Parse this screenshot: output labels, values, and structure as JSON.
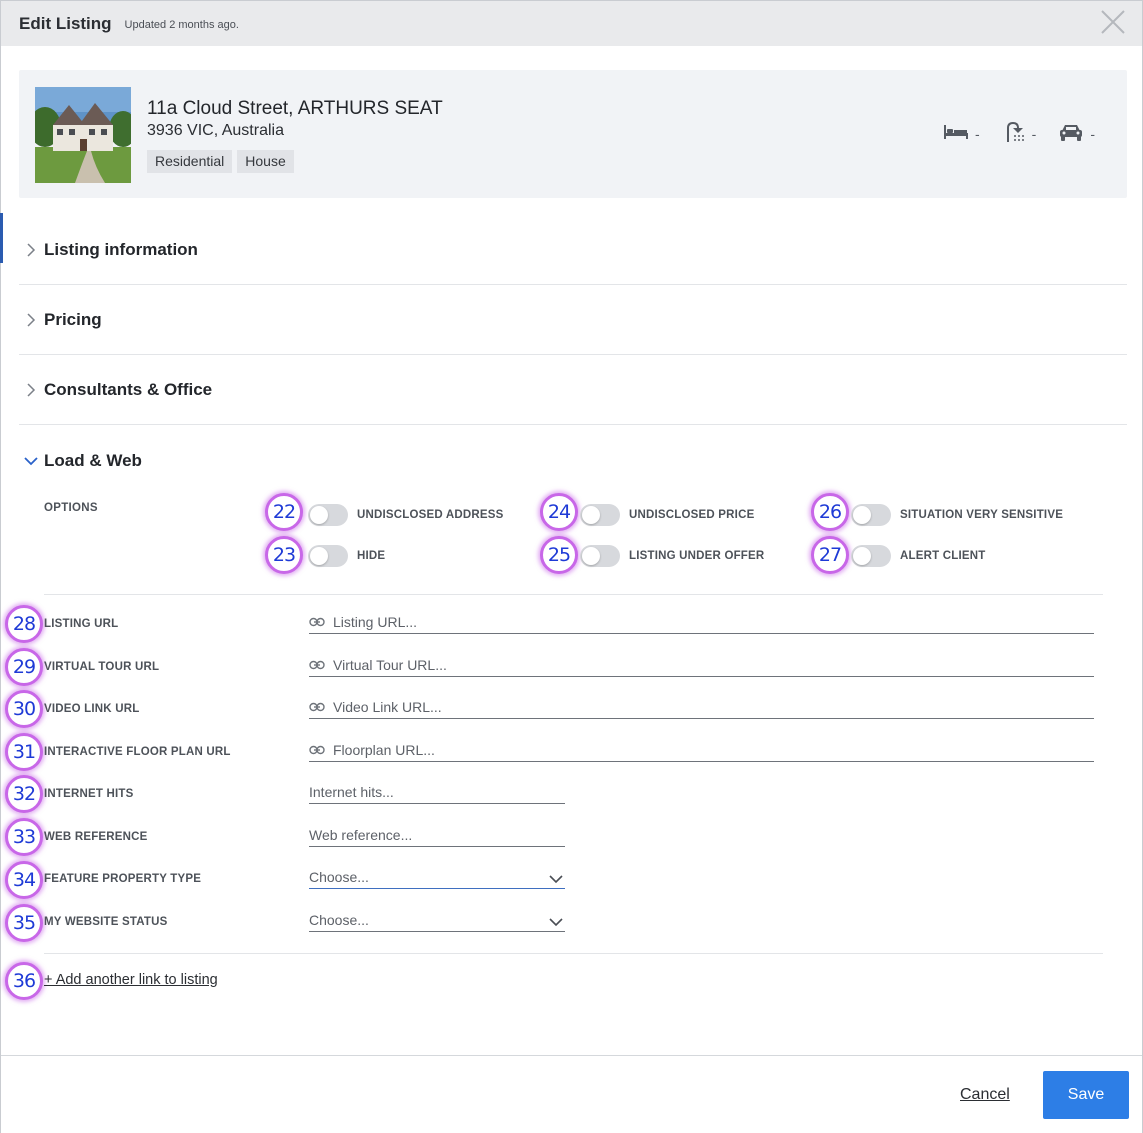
{
  "header": {
    "title": "Edit Listing",
    "subtitle": "Updated 2 months ago."
  },
  "listing": {
    "address": "11a Cloud Street, ARTHURS SEAT",
    "address_sub": "3936 VIC, Australia",
    "tags": [
      "Residential",
      "House"
    ],
    "features": [
      {
        "icon": "bed-icon",
        "value": "-"
      },
      {
        "icon": "shower-icon",
        "value": "-"
      },
      {
        "icon": "car-icon",
        "value": "-"
      }
    ]
  },
  "sections": [
    {
      "label": "Listing information",
      "open": false
    },
    {
      "label": "Pricing",
      "open": false
    },
    {
      "label": "Consultants & Office",
      "open": false
    },
    {
      "label": "Load & Web",
      "open": true
    }
  ],
  "options": {
    "label": "OPTIONS",
    "toggles": [
      {
        "badge": "22",
        "label": "UNDISCLOSED ADDRESS",
        "on": false
      },
      {
        "badge": "23",
        "label": "HIDE",
        "on": false
      },
      {
        "badge": "24",
        "label": "UNDISCLOSED PRICE",
        "on": false
      },
      {
        "badge": "25",
        "label": "LISTING UNDER OFFER",
        "on": false
      },
      {
        "badge": "26",
        "label": "SITUATION VERY SENSITIVE",
        "on": false
      },
      {
        "badge": "27",
        "label": "ALERT CLIENT",
        "on": false
      }
    ]
  },
  "fields": [
    {
      "badge": "28",
      "label": "LISTING URL",
      "placeholder": "Listing URL...",
      "kind": "url"
    },
    {
      "badge": "29",
      "label": "VIRTUAL TOUR URL",
      "placeholder": "Virtual Tour URL...",
      "kind": "url"
    },
    {
      "badge": "30",
      "label": "VIDEO LINK URL",
      "placeholder": "Video Link URL...",
      "kind": "url"
    },
    {
      "badge": "31",
      "label": "INTERACTIVE FLOOR PLAN URL",
      "placeholder": "Floorplan URL...",
      "kind": "url"
    },
    {
      "badge": "32",
      "label": "INTERNET HITS",
      "placeholder": "Internet hits...",
      "kind": "text"
    },
    {
      "badge": "33",
      "label": "WEB REFERENCE",
      "placeholder": "Web reference...",
      "kind": "text"
    },
    {
      "badge": "34",
      "label": "FEATURE PROPERTY TYPE",
      "placeholder": "Choose...",
      "kind": "select"
    },
    {
      "badge": "35",
      "label": "MY WEBSITE STATUS",
      "placeholder": "Choose...",
      "kind": "select"
    }
  ],
  "add_link": {
    "badge": "36",
    "label": "+ Add another link to listing"
  },
  "footer": {
    "cancel_label": "Cancel",
    "save_label": "Save"
  },
  "colors": {
    "accent": "#2d7ee6",
    "badge_ring": "#c867e8",
    "badge_text": "#1e3ad6",
    "toggle_off": "#d7d9dd"
  }
}
